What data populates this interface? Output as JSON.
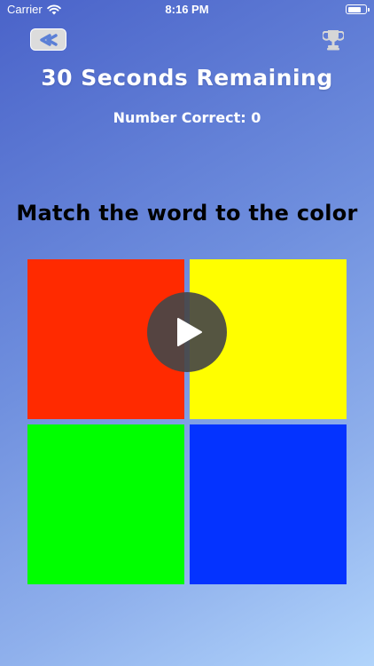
{
  "status_bar": {
    "carrier": "Carrier",
    "time": "8:16 PM",
    "battery_level": 0.8,
    "wifi_icon": "wifi-icon",
    "battery_icon": "battery-icon"
  },
  "toolbar": {
    "back_icon": "chevron-left-icon",
    "trophy_icon": "trophy-icon"
  },
  "game": {
    "timer_text": "30 Seconds Remaining",
    "score_text": "Number Correct: 0",
    "instruction": "Match the word to the color"
  },
  "tiles": [
    {
      "id": "red",
      "color": "#ff2a00"
    },
    {
      "id": "yellow",
      "color": "#fffe00"
    },
    {
      "id": "green",
      "color": "#00ff00"
    },
    {
      "id": "blue",
      "color": "#0433ff"
    }
  ],
  "play_button": {
    "icon": "play-icon",
    "color": "#464646"
  },
  "colors": {
    "background_start": "#4a63c9",
    "background_end": "#b1d4fb",
    "text": "#ffffff",
    "instruction_text": "#000000"
  }
}
